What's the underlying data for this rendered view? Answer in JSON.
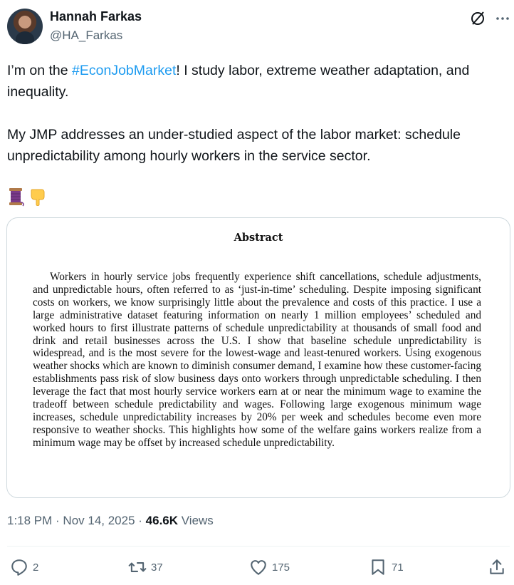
{
  "author": {
    "display_name": "Hannah Farkas",
    "handle": "@HA_Farkas"
  },
  "tweet": {
    "text_before_tag": "I’m on the ",
    "hashtag": "#EconJobMarket",
    "text_after_tag": "! I study labor, extreme weather adaptation, and inequality.",
    "paragraph_2": "My JMP addresses an under-studied aspect of the labor market: schedule unpredictability among hourly workers in the service sector.",
    "emojis": [
      "thread-spool-emoji",
      "pointing-down-emoji"
    ]
  },
  "abstract_image": {
    "title": "Abstract",
    "body": "Workers in hourly service jobs frequently experience shift cancellations, schedule adjust­ments, and unpredictable hours, often referred to as ‘just-in-time’ scheduling. Despite impos­ing significant costs on workers, we know surprisingly little about the prevalence and costs of this practice. I use a large administrative dataset featuring information on nearly 1 million employees’ scheduled and worked hours to first illustrate patterns of schedule unpredictability at thousands of small food and drink and retail businesses across the U.S. I show that baseline schedule unpredictability is widespread, and is the most severe for the lowest-wage and least-tenured workers. Using exogenous weather shocks which are known to diminish consumer demand, I examine how these customer-facing establishments pass risk of slow business days onto workers through unpredictable scheduling. I then leverage the fact that most hourly service workers earn at or near the minimum wage to examine the tradeoff between schedule predictability and wages. Following large exogenous minimum wage increases, schedule unpre­dictability increases by 20% per week and schedules become even more responsive to weather shocks. This highlights how some of the welfare gains workers realize from a minimum wage may be offset by increased schedule unpredictability."
  },
  "meta": {
    "time": "1:18 PM",
    "separator": " · ",
    "date": "Nov 14, 2025",
    "views_count": "46.6K",
    "views_label": " Views"
  },
  "actions": {
    "replies": "2",
    "reposts": "37",
    "likes": "175",
    "bookmarks": "71"
  },
  "colors": {
    "link": "#1d9bf0",
    "muted": "#536471",
    "text": "#0f1419",
    "border": "#cfd9de"
  }
}
